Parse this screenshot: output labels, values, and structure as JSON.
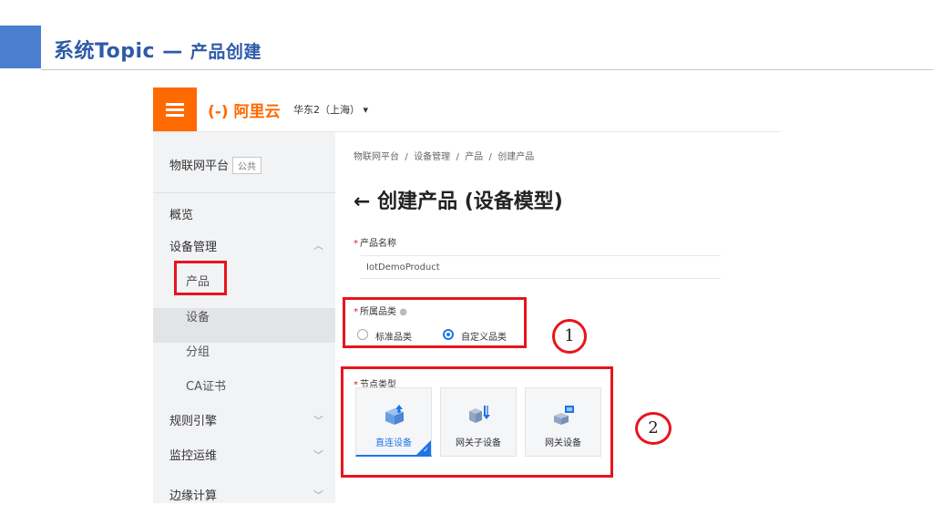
{
  "slide": {
    "title": "系统Topic — ",
    "subtitle": "产品创建",
    "accent_color": "#4a7fd0",
    "title_color": "#2f5aa8"
  },
  "console": {
    "brand": "(-) 阿里云",
    "region": "华东2（上海）",
    "menu_icon": "hamburger-icon",
    "sidebar": {
      "platform_label": "物联网平台",
      "platform_tag": "公共",
      "items": [
        {
          "label": "概览"
        },
        {
          "label": "设备管理"
        },
        {
          "label": "产品"
        },
        {
          "label": "设备"
        },
        {
          "label": "分组"
        },
        {
          "label": "CA证书"
        },
        {
          "label": "规则引擎"
        },
        {
          "label": "监控运维"
        },
        {
          "label": "边缘计算"
        }
      ]
    },
    "breadcrumb": [
      "物联网平台",
      "设备管理",
      "产品",
      "创建产品"
    ],
    "breadcrumb_sep": "/",
    "page_title": "← 创建产品 (设备模型)",
    "form": {
      "product_name_label": "产品名称",
      "product_name_value": "IotDemoProduct",
      "category_label": "所属品类",
      "category_options": [
        "标准品类",
        "自定义品类"
      ],
      "category_selected": "自定义品类",
      "node_type_label": "节点类型",
      "node_types": [
        "直连设备",
        "网关子设备",
        "网关设备"
      ],
      "node_type_selected": "直连设备"
    }
  },
  "annotations": {
    "marker_1": "1",
    "marker_2": "2",
    "highlight_color": "#e8141c"
  }
}
